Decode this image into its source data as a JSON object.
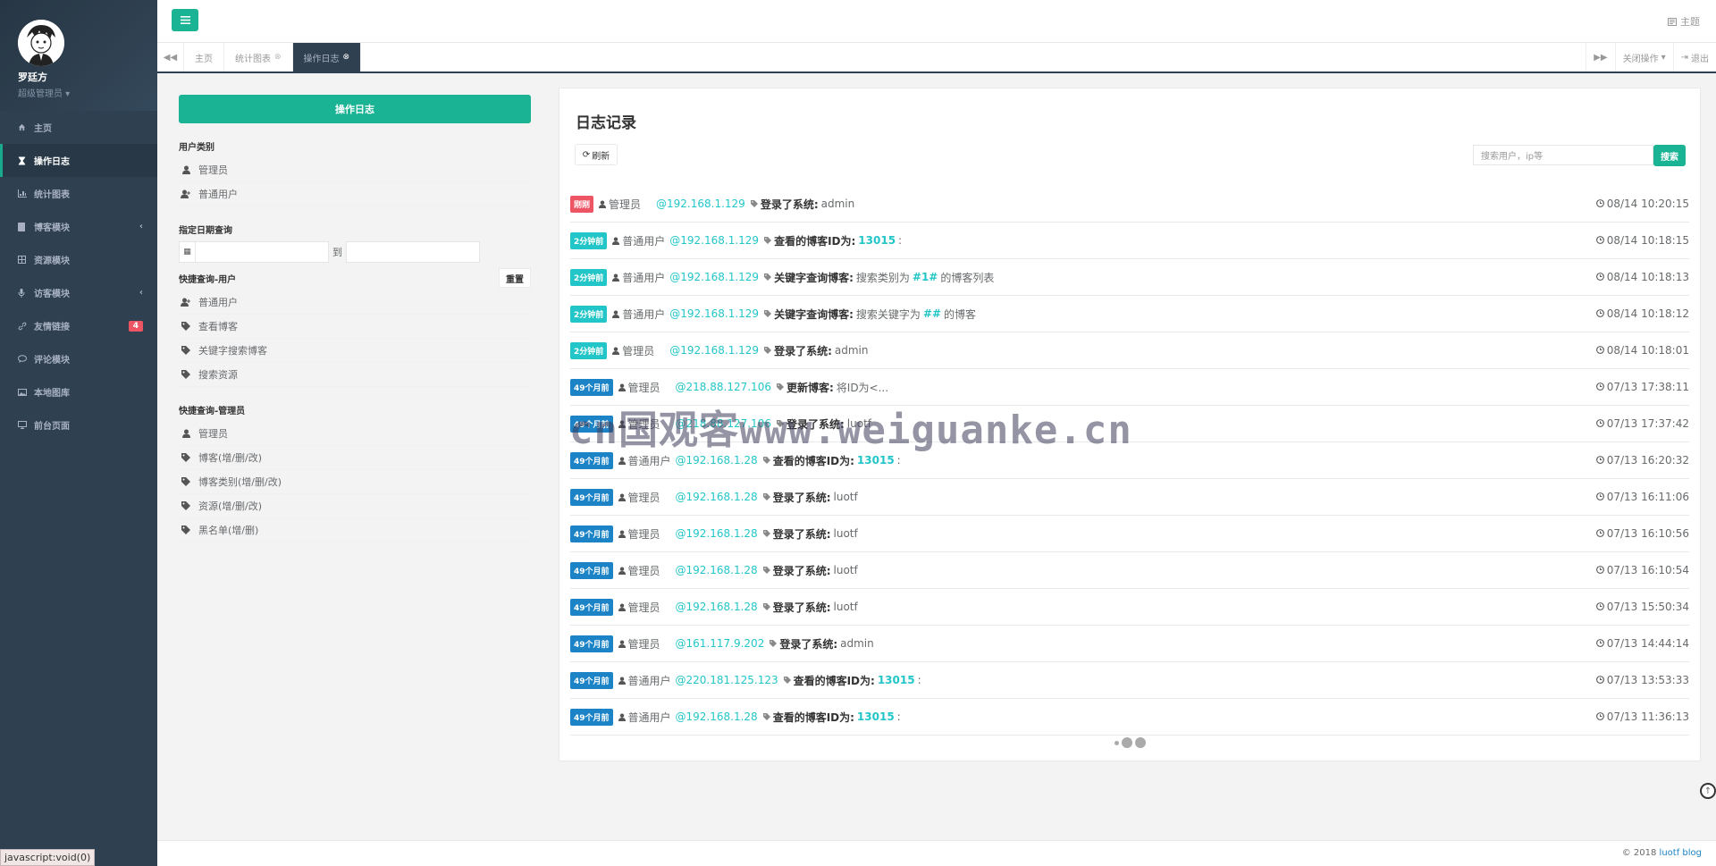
{
  "profile": {
    "name": "罗廷方",
    "role": "超级管理员"
  },
  "nav": [
    {
      "label": "主页",
      "icon": "home-icon"
    },
    {
      "label": "操作日志",
      "icon": "hourglass-icon",
      "active": true
    },
    {
      "label": "统计图表",
      "icon": "bar-chart-icon"
    },
    {
      "label": "博客模块",
      "icon": "book-icon",
      "arrow": "‹"
    },
    {
      "label": "资源模块",
      "icon": "grid-icon"
    },
    {
      "label": "访客模块",
      "icon": "microphone-icon",
      "arrow": "‹"
    },
    {
      "label": "友情链接",
      "icon": "link-icon",
      "badge": "4"
    },
    {
      "label": "评论模块",
      "icon": "comment-icon"
    },
    {
      "label": "本地图库",
      "icon": "image-icon"
    },
    {
      "label": "前台页面",
      "icon": "monitor-icon"
    }
  ],
  "status_url": "javascript:void(0)",
  "header": {
    "theme": "主题"
  },
  "tabs": [
    {
      "label": "主页"
    },
    {
      "label": "统计图表",
      "closable": true
    },
    {
      "label": "操作日志",
      "closable": true,
      "active": true
    }
  ],
  "tabs_right": {
    "close_ops": "关闭操作",
    "logout": "退出"
  },
  "left": {
    "main_button": "操作日志",
    "user_type_title": "用户类别",
    "user_types": [
      "管理员",
      "普通用户"
    ],
    "date_title": "指定日期查询",
    "date_to": "到",
    "reset": "重置",
    "quick_user_title": "快捷查询-用户",
    "quick_user": [
      "普通用户",
      "查看博客",
      "关键字搜索博客",
      "搜索资源"
    ],
    "quick_admin_title": "快捷查询-管理员",
    "quick_admin": [
      "管理员",
      "博客(增/删/改)",
      "博客类别(增/删/改)",
      "资源(增/删/改)",
      "黑名单(增/删)"
    ]
  },
  "log": {
    "title": "日志记录",
    "refresh": "刷新",
    "search_placeholder": "搜索用户，ip等",
    "search_btn": "搜索",
    "rows": [
      {
        "badge": "刚刚",
        "color": "red",
        "user": "管理员",
        "ip": "@192.168.1.129",
        "action": "登录了系统:",
        "detail": "admin",
        "time": "08/14 10:20:15"
      },
      {
        "badge": "2分钟前",
        "color": "teal",
        "user": "普通用户",
        "ip": "@192.168.1.129",
        "action": "查看的博客ID为:",
        "hl": "13015",
        "suffix": ":",
        "time": "08/14 10:18:15"
      },
      {
        "badge": "2分钟前",
        "color": "teal",
        "user": "普通用户",
        "ip": "@192.168.1.129",
        "action": "关键字查询博客:",
        "detail": "搜索类别为",
        "hl": "#1#",
        "suffix": "的博客列表",
        "time": "08/14 10:18:13"
      },
      {
        "badge": "2分钟前",
        "color": "teal",
        "user": "普通用户",
        "ip": "@192.168.1.129",
        "action": "关键字查询博客:",
        "detail": "搜索关键字为",
        "hl": "##",
        "suffix": "的博客",
        "time": "08/14 10:18:12"
      },
      {
        "badge": "2分钟前",
        "color": "teal",
        "user": "管理员",
        "ip": "@192.168.1.129",
        "action": "登录了系统:",
        "detail": "admin",
        "time": "08/14 10:18:01"
      },
      {
        "badge": "49个月前",
        "color": "blue",
        "user": "管理员",
        "ip": "@218.88.127.106",
        "action": "更新博客:",
        "detail": "将ID为<...",
        "time": "07/13 17:38:11"
      },
      {
        "badge": "49个月前",
        "color": "blue",
        "user": "管理员",
        "ip": "@218.88.127.106",
        "action": "登录了系统:",
        "detail": "luotf",
        "time": "07/13 17:37:42"
      },
      {
        "badge": "49个月前",
        "color": "blue",
        "user": "普通用户",
        "ip": "@192.168.1.28",
        "action": "查看的博客ID为:",
        "hl": "13015",
        "suffix": ":",
        "time": "07/13 16:20:32"
      },
      {
        "badge": "49个月前",
        "color": "blue",
        "user": "管理员",
        "ip": "@192.168.1.28",
        "action": "登录了系统:",
        "detail": "luotf",
        "time": "07/13 16:11:06"
      },
      {
        "badge": "49个月前",
        "color": "blue",
        "user": "管理员",
        "ip": "@192.168.1.28",
        "action": "登录了系统:",
        "detail": "luotf",
        "time": "07/13 16:10:56"
      },
      {
        "badge": "49个月前",
        "color": "blue",
        "user": "管理员",
        "ip": "@192.168.1.28",
        "action": "登录了系统:",
        "detail": "luotf",
        "time": "07/13 16:10:54"
      },
      {
        "badge": "49个月前",
        "color": "blue",
        "user": "管理员",
        "ip": "@192.168.1.28",
        "action": "登录了系统:",
        "detail": "luotf",
        "time": "07/13 15:50:34"
      },
      {
        "badge": "49个月前",
        "color": "blue",
        "user": "管理员",
        "ip": "@161.117.9.202",
        "action": "登录了系统:",
        "detail": "admin",
        "time": "07/13 14:44:14"
      },
      {
        "badge": "49个月前",
        "color": "blue",
        "user": "普通用户",
        "ip": "@220.181.125.123",
        "action": "查看的博客ID为:",
        "hl": "13015",
        "suffix": ":",
        "time": "07/13 13:53:33"
      },
      {
        "badge": "49个月前",
        "color": "blue",
        "user": "普通用户",
        "ip": "@192.168.1.28",
        "action": "查看的博客ID为:",
        "hl": "13015",
        "suffix": ":",
        "time": "07/13 11:36:13"
      }
    ]
  },
  "watermark": "cn国观客www.weiguanke.cn",
  "footer": {
    "prefix": "© 2018 ",
    "link": "luotf blog"
  },
  "colors": {
    "primary": "#1ab394",
    "sidebar": "#2f4050",
    "info": "#23c6c8",
    "success": "#1c84c6",
    "danger": "#ed5565"
  }
}
